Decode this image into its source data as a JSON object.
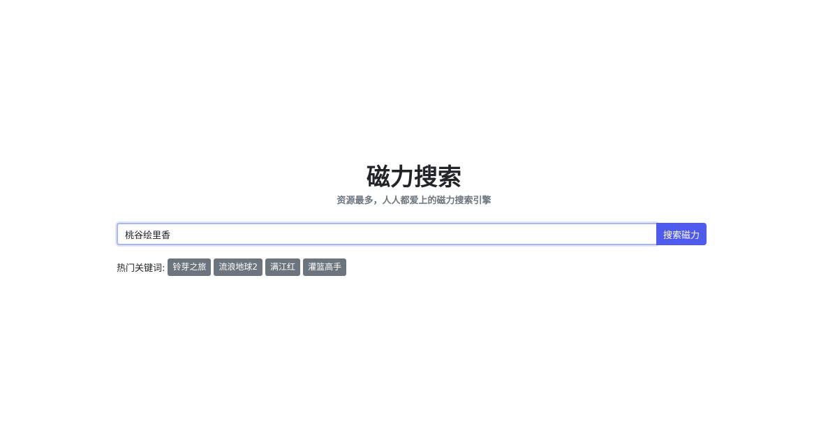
{
  "header": {
    "title": "磁力搜索",
    "subtitle": "资源最多，人人都爱上的磁力搜索引擎"
  },
  "search": {
    "value": "桃谷绘里香",
    "button_label": "搜索磁力"
  },
  "hot_keywords": {
    "label": "热门关键词:",
    "items": [
      {
        "label": "铃芽之旅"
      },
      {
        "label": "流浪地球2"
      },
      {
        "label": "满江红"
      },
      {
        "label": "灌篮高手"
      }
    ]
  },
  "colors": {
    "accent": "#4f5bef",
    "tag_background": "#6c757d",
    "subtitle_text": "#6c757d"
  }
}
